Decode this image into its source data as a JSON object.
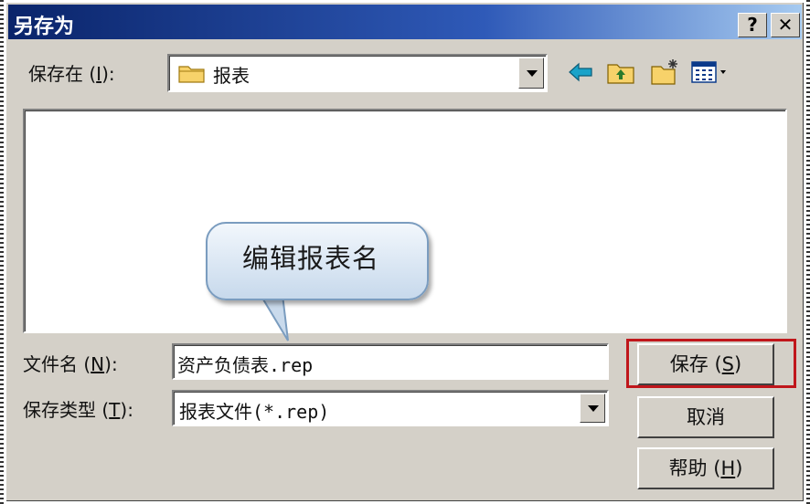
{
  "dialog": {
    "title": "另存为",
    "help_button": "?",
    "close_button": "✕"
  },
  "save_in": {
    "label_prefix": "保存在 (",
    "label_key": "I",
    "label_suffix": "):",
    "value": "报表"
  },
  "toolbar": {
    "icons": [
      "back-arrow-icon",
      "up-folder-icon",
      "new-folder-icon",
      "view-menu-icon"
    ]
  },
  "callout": {
    "text": "编辑报表名"
  },
  "file_name": {
    "label_prefix": "文件名 (",
    "label_key": "N",
    "label_suffix": "):",
    "value": "资产负债表.rep"
  },
  "file_type": {
    "label_prefix": "保存类型 (",
    "label_key": "T",
    "label_suffix": "):",
    "value": "报表文件(*.rep)"
  },
  "buttons": {
    "save_prefix": "保存 (",
    "save_key": "S",
    "save_suffix": ")",
    "cancel": "取消",
    "help_prefix": "帮助 (",
    "help_key": "H",
    "help_suffix": ")"
  },
  "colors": {
    "title_bar": "#0a246a",
    "highlight": "#c0161b",
    "folder": "#f7d26a",
    "arrow": "#1aa3c9"
  }
}
